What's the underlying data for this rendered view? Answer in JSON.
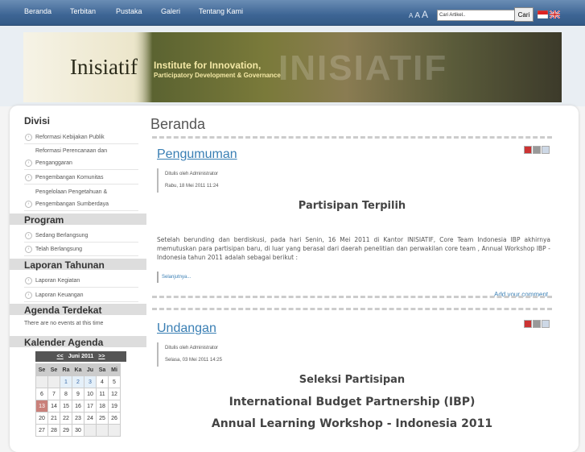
{
  "nav": {
    "items": [
      "Beranda",
      "Terbitan",
      "Pustaka",
      "Galeri",
      "Tentang Kami"
    ]
  },
  "font_controls": [
    "A",
    "A",
    "A"
  ],
  "search": {
    "placeholder": "Cari Artikel..",
    "button": "Cari"
  },
  "banner": {
    "logo_text": "Inisiatif",
    "tagline_line1": "Institute for Innovation,",
    "tagline_line2": "Participatory Development & Governance",
    "watermark": "INISIATIF"
  },
  "sidebar": {
    "divisi_title": "Divisi",
    "divisi_items": [
      "Reformasi Kebijakan Publik",
      "Reformasi Perencanaan dan",
      "Penganggaran",
      "Pengembangan Komunitas",
      "Pengelolaan Pengetahuan &",
      "Pengembangan Sumberdaya"
    ],
    "program_title": "Program",
    "program_items": [
      "Sedang Berlangsung",
      "Telah Berlangsung"
    ],
    "laporan_title": "Laporan Tahunan",
    "laporan_items": [
      "Laporan Kegiatan",
      "Laporan Keuangan"
    ],
    "agenda_title": "Agenda Terdekat",
    "agenda_text": "There are no events at this time",
    "kalender_title": "Kalender Agenda"
  },
  "calendar": {
    "prev": "<<",
    "month": "Juni 2011",
    "next": ">>",
    "days": [
      "Se",
      "Se",
      "Ra",
      "Ka",
      "Ju",
      "Sa",
      "Mi"
    ],
    "row1": [
      "",
      "",
      "1",
      "2",
      "3",
      "4",
      "5"
    ],
    "row2": [
      "6",
      "7",
      "8",
      "9",
      "10",
      "11",
      "12"
    ],
    "row3": [
      "13",
      "14",
      "15",
      "16",
      "17",
      "18",
      "19"
    ],
    "row4": [
      "20",
      "21",
      "22",
      "23",
      "24",
      "25",
      "26"
    ],
    "row5": [
      "27",
      "28",
      "29",
      "30",
      "",
      "",
      ""
    ]
  },
  "main": {
    "page_title": "Beranda",
    "article1": {
      "title": "Pengumuman",
      "author": "Ditulis oleh Administrator",
      "date": "Rabu, 18 Mei 2011 11:24",
      "heading": "Partisipan Terpilih",
      "body": "Setelah berunding dan berdiskusi, pada hari Senin, 16 Mei 2011 di Kantor INISIATIF, Core Team Indonesia IBP akhirnya memutuskan para partisipan baru, di luar yang berasal dari daerah penelitian dan perwakilan core team , Annual Workshop IBP - Indonesia tahun 2011 adalah sebagai berikut :",
      "read_more": "Selanjutnya...",
      "add_comment": "Add your comment"
    },
    "article2": {
      "title": "Undangan",
      "author": "Ditulis oleh Administrator",
      "date": "Selasa, 03 Mei 2011 14:25",
      "heading1": "Seleksi Partisipan",
      "heading2": "International Budget Partnership (IBP)",
      "heading3": "Annual Learning Workshop - Indonesia 2011"
    }
  }
}
